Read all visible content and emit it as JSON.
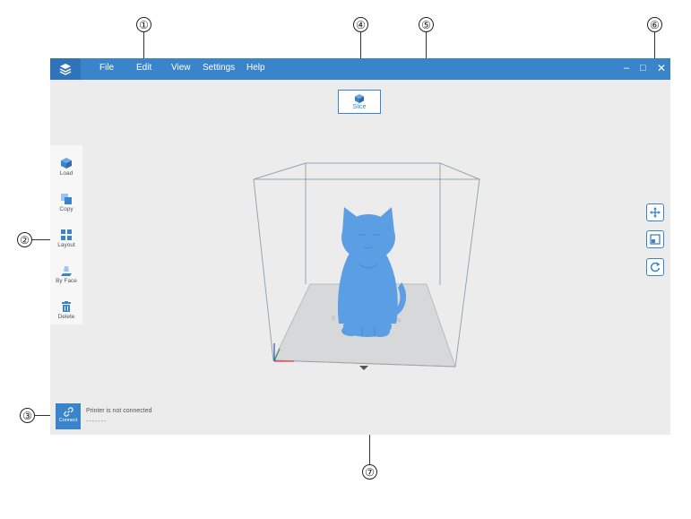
{
  "window": {
    "menu": [
      "File",
      "Edit",
      "View",
      "Settings",
      "Help"
    ],
    "controls": {
      "minimize": "–",
      "maximize": "□",
      "close": "✕"
    }
  },
  "slice": {
    "label": "Slice"
  },
  "left_toolbar": [
    {
      "label": "Load",
      "icon": "load-icon"
    },
    {
      "label": "Copy",
      "icon": "copy-icon"
    },
    {
      "label": "Layout",
      "icon": "layout-icon"
    },
    {
      "label": "By Face",
      "icon": "by-face-icon"
    },
    {
      "label": "Delete",
      "icon": "delete-icon"
    }
  ],
  "right_toolbar": [
    {
      "icon": "move-icon"
    },
    {
      "icon": "scale-icon"
    },
    {
      "icon": "rotate-icon"
    }
  ],
  "connect": {
    "label": "Connect",
    "icon": "link-icon"
  },
  "printer": {
    "status": "Printer is not connected",
    "sub": "-------"
  },
  "callouts": [
    "①",
    "②",
    "③",
    "④",
    "⑤",
    "⑥",
    "⑦"
  ],
  "colors": {
    "accent": "#3a84cc",
    "model": "#5b9ee3",
    "canvas": "#ececec"
  }
}
